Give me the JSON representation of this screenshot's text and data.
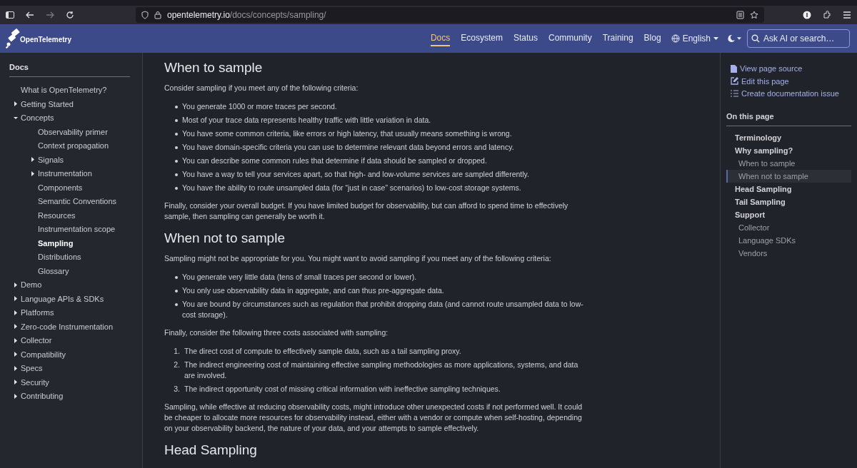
{
  "browser": {
    "url_host": "opentelemetry.io",
    "url_path": "/docs/concepts/sampling/"
  },
  "navbar": {
    "logo": "OpenTelemetry",
    "links": [
      {
        "label": "Docs",
        "selected": true
      },
      {
        "label": "Ecosystem",
        "selected": false
      },
      {
        "label": "Status",
        "selected": false
      },
      {
        "label": "Community",
        "selected": false
      },
      {
        "label": "Training",
        "selected": false
      },
      {
        "label": "Blog",
        "selected": false
      }
    ],
    "language": "English",
    "search": {
      "placeholder": "Ask AI or search…"
    }
  },
  "sidebar": {
    "title": "Docs",
    "items": [
      {
        "label": "What is OpenTelemetry?",
        "kind": "page",
        "selected": false
      },
      {
        "label": "Getting Started",
        "kind": "folder",
        "expanded": false,
        "selected": false
      },
      {
        "label": "Concepts",
        "kind": "folder",
        "expanded": true,
        "selected": false,
        "children": [
          {
            "label": "Observability primer",
            "kind": "page",
            "selected": false
          },
          {
            "label": "Context propagation",
            "kind": "page",
            "selected": false
          },
          {
            "label": "Signals",
            "kind": "folder",
            "expanded": false,
            "selected": false
          },
          {
            "label": "Instrumentation",
            "kind": "folder",
            "expanded": false,
            "selected": false
          },
          {
            "label": "Components",
            "kind": "page",
            "selected": false
          },
          {
            "label": "Semantic Conventions",
            "kind": "page",
            "selected": false
          },
          {
            "label": "Resources",
            "kind": "page",
            "selected": false
          },
          {
            "label": "Instrumentation scope",
            "kind": "page",
            "selected": false
          },
          {
            "label": "Sampling",
            "kind": "page",
            "selected": true
          },
          {
            "label": "Distributions",
            "kind": "page",
            "selected": false
          },
          {
            "label": "Glossary",
            "kind": "page",
            "selected": false
          }
        ]
      },
      {
        "label": "Demo",
        "kind": "folder",
        "expanded": false,
        "selected": false
      },
      {
        "label": "Language APIs & SDKs",
        "kind": "folder",
        "expanded": false,
        "selected": false
      },
      {
        "label": "Platforms",
        "kind": "folder",
        "expanded": false,
        "selected": false
      },
      {
        "label": "Zero-code Instrumentation",
        "kind": "folder",
        "expanded": false,
        "selected": false
      },
      {
        "label": "Collector",
        "kind": "folder",
        "expanded": false,
        "selected": false
      },
      {
        "label": "Compatibility",
        "kind": "folder",
        "expanded": false,
        "selected": false
      },
      {
        "label": "Specs",
        "kind": "folder",
        "expanded": false,
        "selected": false
      },
      {
        "label": "Security",
        "kind": "folder",
        "expanded": false,
        "selected": false
      },
      {
        "label": "Contributing",
        "kind": "folder",
        "expanded": false,
        "selected": false
      }
    ]
  },
  "content": [
    {
      "kind": "heading",
      "text": "When to sample"
    },
    {
      "kind": "paragraph",
      "text": "Consider sampling if you meet any of the following criteria:"
    },
    {
      "kind": "bullets",
      "items": [
        "You generate 1000 or more traces per second.",
        "Most of your trace data represents healthy traffic with little variation in data.",
        "You have some common criteria, like errors or high latency, that usually means something is wrong.",
        "You have domain-specific criteria you can use to determine relevant data beyond errors and latency.",
        "You can describe some common rules that determine if data should be sampled or dropped.",
        "You have a way to tell your services apart, so that high- and low-volume services are sampled differently.",
        "You have the ability to route unsampled data (for “just in case” scenarios) to low-cost storage systems."
      ]
    },
    {
      "kind": "paragraph",
      "text": "Finally, consider your overall budget. If you have limited budget for observability, but can afford to spend time to effectively sample, then sampling can generally be worth it."
    },
    {
      "kind": "heading",
      "text": "When not to sample"
    },
    {
      "kind": "paragraph",
      "text": "Sampling might not be appropriate for you. You might want to avoid sampling if you meet any of the following criteria:"
    },
    {
      "kind": "bullets",
      "items": [
        "You generate very little data (tens of small traces per second or lower).",
        "You only use observability data in aggregate, and can thus pre-aggregate data.",
        "You are bound by circumstances such as regulation that prohibit dropping data (and cannot route unsampled data to low-cost storage)."
      ]
    },
    {
      "kind": "paragraph",
      "text": "Finally, consider the following three costs associated with sampling:"
    },
    {
      "kind": "numbered",
      "items": [
        {
          "number": "1.",
          "text": "The direct cost of compute to effectively sample data, such as a tail sampling proxy."
        },
        {
          "number": "2.",
          "text": "The indirect engineering cost of maintaining effective sampling methodologies as more applications, systems, and data are involved."
        },
        {
          "number": "3.",
          "text": "The indirect opportunity cost of missing critical information with ineffective sampling techniques."
        }
      ]
    },
    {
      "kind": "paragraph",
      "text": "Sampling, while effective at reducing observability costs, might introduce other unexpected costs if not performed well. It could be cheaper to allocate more resources for observability instead, either with a vendor or compute when self-hosting, depending on your observability backend, the nature of your data, and your attempts to sample effectively."
    },
    {
      "kind": "heading",
      "text": "Head Sampling"
    }
  ],
  "page_actions": [
    {
      "kind": "source",
      "label": "View page source"
    },
    {
      "kind": "edit",
      "label": "Edit this page"
    },
    {
      "kind": "issue",
      "label": "Create documentation issue"
    }
  ],
  "toc": {
    "title": "On this page",
    "items": [
      {
        "label": "Terminology",
        "selected": false
      },
      {
        "label": "Why sampling?",
        "selected": false,
        "children": [
          {
            "label": "When to sample",
            "selected": false
          },
          {
            "label": "When not to sample",
            "selected": true
          }
        ]
      },
      {
        "label": "Head Sampling",
        "selected": false
      },
      {
        "label": "Tail Sampling",
        "selected": false
      },
      {
        "label": "Support",
        "selected": false,
        "children": [
          {
            "label": "Collector",
            "selected": false
          },
          {
            "label": "Language SDKs",
            "selected": false
          },
          {
            "label": "Vendors",
            "selected": false
          }
        ]
      }
    ]
  }
}
